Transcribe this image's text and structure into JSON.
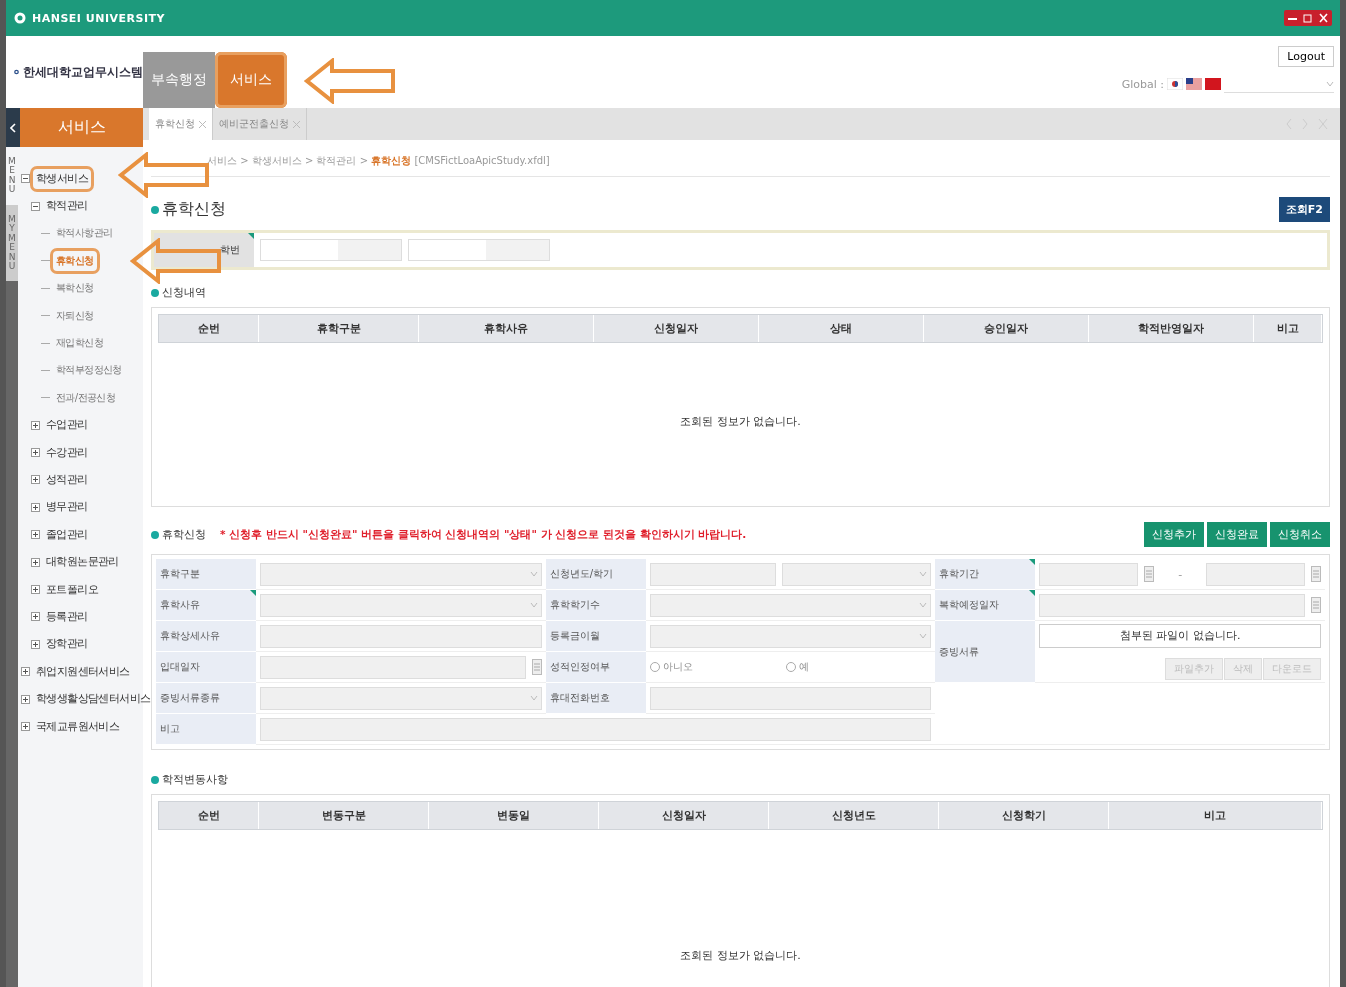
{
  "window": {
    "title": "HANSEI UNIVERSITY"
  },
  "header": {
    "system_name": "한세대학교업무시스템",
    "logout": "Logout",
    "global_label": "Global :"
  },
  "top_tabs": [
    {
      "label": "부속행정",
      "selected": false,
      "highlighted": false
    },
    {
      "label": "서비스",
      "selected": true,
      "highlighted": true
    }
  ],
  "sidebar": {
    "title": "서비스",
    "menu_tab": "MENU",
    "mymenu_tab": "MYMENU",
    "items": [
      {
        "label": "학생서비스",
        "expanded": true,
        "selected": false,
        "highlighted": true,
        "children": [
          {
            "label": "학적관리",
            "expanded": true,
            "selected": false,
            "highlighted": false,
            "children": [
              {
                "label": "학적사항관리",
                "selected": false,
                "highlighted": false
              },
              {
                "label": "휴학신청",
                "selected": true,
                "highlighted": true
              },
              {
                "label": "복학신청",
                "selected": false,
                "highlighted": false
              },
              {
                "label": "자퇴신청",
                "selected": false,
                "highlighted": false
              },
              {
                "label": "재입학신청",
                "selected": false,
                "highlighted": false
              },
              {
                "label": "학적부정정신청",
                "selected": false,
                "highlighted": false
              },
              {
                "label": "전과/전공신청",
                "selected": false,
                "highlighted": false
              }
            ]
          },
          {
            "label": "수업관리",
            "expanded": false,
            "selected": false,
            "highlighted": false
          },
          {
            "label": "수강관리",
            "expanded": false,
            "selected": false,
            "highlighted": false
          },
          {
            "label": "성적관리",
            "expanded": false,
            "selected": false,
            "highlighted": false
          },
          {
            "label": "병무관리",
            "expanded": false,
            "selected": false,
            "highlighted": false
          },
          {
            "label": "졸업관리",
            "expanded": false,
            "selected": false,
            "highlighted": false
          },
          {
            "label": "대학원논문관리",
            "expanded": false,
            "selected": false,
            "highlighted": false
          },
          {
            "label": "포트폴리오",
            "expanded": false,
            "selected": false,
            "highlighted": false
          },
          {
            "label": "등록관리",
            "expanded": false,
            "selected": false,
            "highlighted": false
          },
          {
            "label": "장학관리",
            "expanded": false,
            "selected": false,
            "highlighted": false
          }
        ]
      },
      {
        "label": "취업지원센터서비스",
        "expanded": false,
        "selected": false,
        "highlighted": false
      },
      {
        "label": "학생생활상담센터서비스",
        "expanded": false,
        "selected": false,
        "highlighted": false
      },
      {
        "label": "국제교류원서비스",
        "expanded": false,
        "selected": false,
        "highlighted": false
      }
    ]
  },
  "doc_tabs": [
    {
      "label": "휴학신청",
      "selected": true
    },
    {
      "label": "예비군전출신청",
      "selected": false
    }
  ],
  "breadcrumb": {
    "path": "서비스 > 학생서비스 > 학적관리 >",
    "current": "휴학신청",
    "file": "[CMSFictLoaApicStudy.xfdl]"
  },
  "page_title": "휴학신청",
  "search_button": "조회F2",
  "search": {
    "label": "학번",
    "required": true
  },
  "history": {
    "title": "신청내역",
    "columns": [
      "순번",
      "휴학구분",
      "휴학사유",
      "신청일자",
      "상태",
      "승인일자",
      "학적반영일자",
      "비고"
    ],
    "empty": "조회된 정보가 없습니다."
  },
  "application": {
    "title": "휴학신청",
    "notice": "* 신청후 반드시 \"신청완료\" 버튼을 클릭하여 신청내역의 \"상태\" 가 신청으로 된것을 확인하시기 바랍니다.",
    "buttons": [
      "신청추가",
      "신청완료",
      "신청취소"
    ],
    "fields": [
      {
        "label": "휴학구분",
        "kind": "select",
        "required": false
      },
      {
        "label": "신청년도/학기",
        "kind": "year_term",
        "required": false
      },
      {
        "label": "휴학기간",
        "kind": "date_range",
        "required": true,
        "separator": "-"
      },
      {
        "label": "휴학사유",
        "kind": "select",
        "required": true
      },
      {
        "label": "휴학학기수",
        "kind": "select",
        "required": false
      },
      {
        "label": "복학예정일자",
        "kind": "date",
        "required": true
      },
      {
        "label": "휴학상세사유",
        "kind": "text",
        "required": false
      },
      {
        "label": "등록금이월",
        "kind": "select",
        "required": false
      },
      {
        "label": "입대일자",
        "kind": "date",
        "required": false
      },
      {
        "label": "성적인정여부",
        "kind": "radio",
        "required": false,
        "options": [
          {
            "label": "아니오",
            "selected": false
          },
          {
            "label": "예",
            "selected": false
          }
        ]
      },
      {
        "label": "증빙서류종류",
        "kind": "select",
        "required": false
      },
      {
        "label": "휴대전화번호",
        "kind": "text",
        "required": false
      },
      {
        "label": "비고",
        "kind": "memo",
        "required": false
      }
    ],
    "attachment": {
      "label": "증빙서류",
      "message": "첨부된 파일이 없습니다.",
      "buttons": [
        {
          "label": "파일추가",
          "disabled": true
        },
        {
          "label": "삭제",
          "disabled": true
        },
        {
          "label": "다운로드",
          "disabled": true
        }
      ]
    }
  },
  "changes": {
    "title": "학적변동사항",
    "columns": [
      "순번",
      "변동구분",
      "변동일",
      "신청일자",
      "신청년도",
      "신청학기",
      "비고"
    ],
    "empty": "조회된 정보가 없습니다."
  }
}
